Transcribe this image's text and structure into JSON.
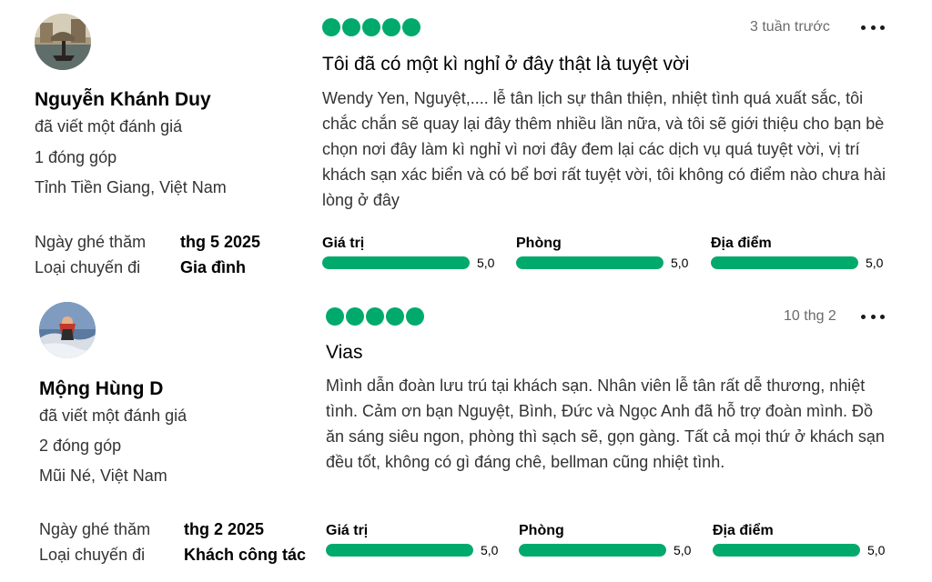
{
  "reviews": [
    {
      "author": {
        "name": "Nguyễn Khánh Duy",
        "action": "đã viết một đánh giá",
        "contributions": "1 đóng góp",
        "location": "Tỉnh Tiền Giang, Việt Nam"
      },
      "visit_label": "Ngày ghé thăm",
      "visit_date": "thg 5 2025",
      "trip_label": "Loại chuyến đi",
      "trip_type": "Gia đình",
      "bubble_rating": 5,
      "date": "3 tuần trước",
      "title": "Tôi đã có một kì nghỉ ở đây thật là tuyệt vời",
      "text": "Wendy Yen, Nguyệt,.... lễ tân lịch sự thân thiện, nhiệt tình quá xuất sắc, tôi chắc chắn sẽ quay lại đây thêm nhiều lần nữa, và tôi sẽ giới thiệu cho bạn bè chọn nơi đây làm kì nghỉ vì nơi đây đem lại các dịch vụ quá tuyệt vời, vị trí khách sạn xác biển và có bể bơi rất tuyệt vời, tôi không có điểm nào chưa hài lòng ở đây",
      "subratings": [
        {
          "label": "Giá trị",
          "value": "5,0",
          "fraction": 1.0
        },
        {
          "label": "Phòng",
          "value": "5,0",
          "fraction": 1.0
        },
        {
          "label": "Địa điểm",
          "value": "5,0",
          "fraction": 1.0
        }
      ]
    },
    {
      "author": {
        "name": "Mộng Hùng D",
        "action": "đã viết một đánh giá",
        "contributions": "2 đóng góp",
        "location": "Mũi Né, Việt Nam"
      },
      "visit_label": "Ngày ghé thăm",
      "visit_date": "thg 2 2025",
      "trip_label": "Loại chuyến đi",
      "trip_type": "Khách công tác",
      "bubble_rating": 5,
      "date": "10 thg 2",
      "title": "Vias",
      "text": "Mình dẫn đoàn lưu trú tại khách sạn. Nhân viên lễ tân rất dễ thương, nhiệt tình. Cảm ơn bạn Nguyệt, Bình, Đức và Ngọc Anh đã hỗ trợ đoàn mình. Đồ ăn sáng siêu ngon, phòng thì sạch sẽ, gọn gàng. Tất cả mọi thứ ở khách sạn đều tốt, không có gì đáng chê, bellman cũng nhiệt tình.",
      "subratings": [
        {
          "label": "Giá trị",
          "value": "5,0",
          "fraction": 1.0
        },
        {
          "label": "Phòng",
          "value": "5,0",
          "fraction": 1.0
        },
        {
          "label": "Địa điểm",
          "value": "5,0",
          "fraction": 1.0
        }
      ]
    }
  ],
  "colors": {
    "bubble": "#00aa6c",
    "bar_fill": "#00aa6c",
    "bar_track": "#e0e0e0",
    "date_text": "#6b6b6b"
  },
  "icons": {
    "more": "more-horizontal-icon",
    "bubble": "rating-bubble-icon"
  }
}
